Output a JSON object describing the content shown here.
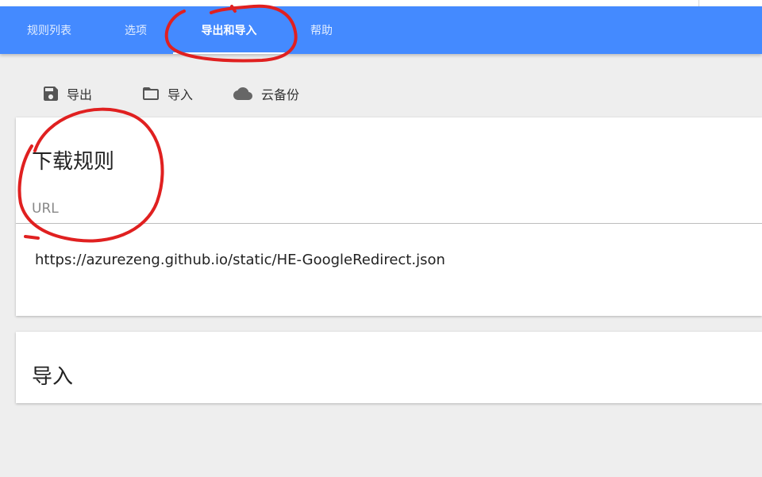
{
  "tabs": [
    {
      "label": "规则列表",
      "active": false
    },
    {
      "label": "选项",
      "active": false
    },
    {
      "label": "导出和导入",
      "active": true
    },
    {
      "label": "帮助",
      "active": false
    }
  ],
  "toolbar": {
    "export_label": "导出",
    "import_label": "导入",
    "cloud_label": "云备份"
  },
  "download_card": {
    "title": "下载规则",
    "url_label": "URL",
    "url_value": "https://azurezeng.github.io/static/HE-GoogleRedirect.json"
  },
  "import_card": {
    "title": "导入"
  },
  "icons": {
    "export": "save-icon",
    "import": "folder-icon",
    "cloud": "cloud-icon"
  },
  "colors": {
    "tabbar": "#448aff",
    "background": "#eeeeee",
    "annotation": "#e02020"
  }
}
